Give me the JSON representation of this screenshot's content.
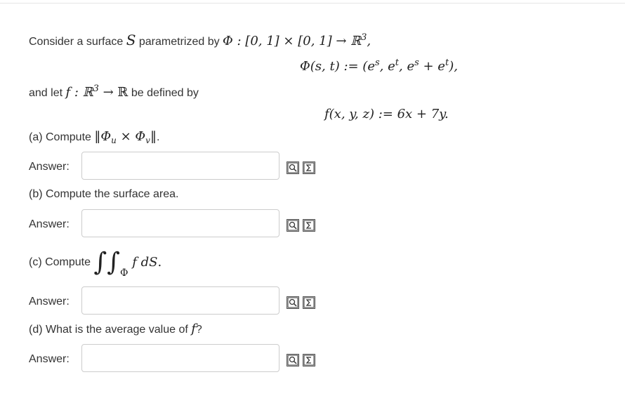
{
  "intro": {
    "lead": "Consider a surface ",
    "S": "S",
    "mid": " parametrized by ",
    "map": "Φ : [0, 1] × [0, 1] → ℝ",
    "map_exp": "3",
    "map_end": ","
  },
  "param_eq": {
    "lhs": "Φ(s, t) := (e",
    "e1_exp": "s",
    "m1": ", e",
    "e2_exp": "t",
    "m2": ", e",
    "e3_exp": "s",
    "m3": " + e",
    "e4_exp": "t",
    "end": "),"
  },
  "let_line": {
    "lead": "and let ",
    "f_map": "f : ℝ",
    "f_exp": "3",
    "arrow": " → ℝ",
    "tail": " be defined by"
  },
  "f_eq": "f(x, y, z) := 6x + 7y.",
  "parts": {
    "a": {
      "label": "(a) Compute",
      "expr_open": "‖Φ",
      "sub1": "u",
      "times": " × Φ",
      "sub2": "v",
      "expr_close": "‖",
      "end": "."
    },
    "b": {
      "label": "(b) Compute the surface area."
    },
    "c": {
      "label": "(c) Compute",
      "integral": "∫∫",
      "domain": "Φ",
      "integrand": "f dS",
      "end": "."
    },
    "d": {
      "label": "(d) What is the average value of",
      "f": "f",
      "end": "?"
    }
  },
  "answers": {
    "label": "Answer:",
    "values": [
      "",
      "",
      "",
      ""
    ]
  },
  "icons": [
    "preview-icon",
    "equation-editor-icon"
  ]
}
